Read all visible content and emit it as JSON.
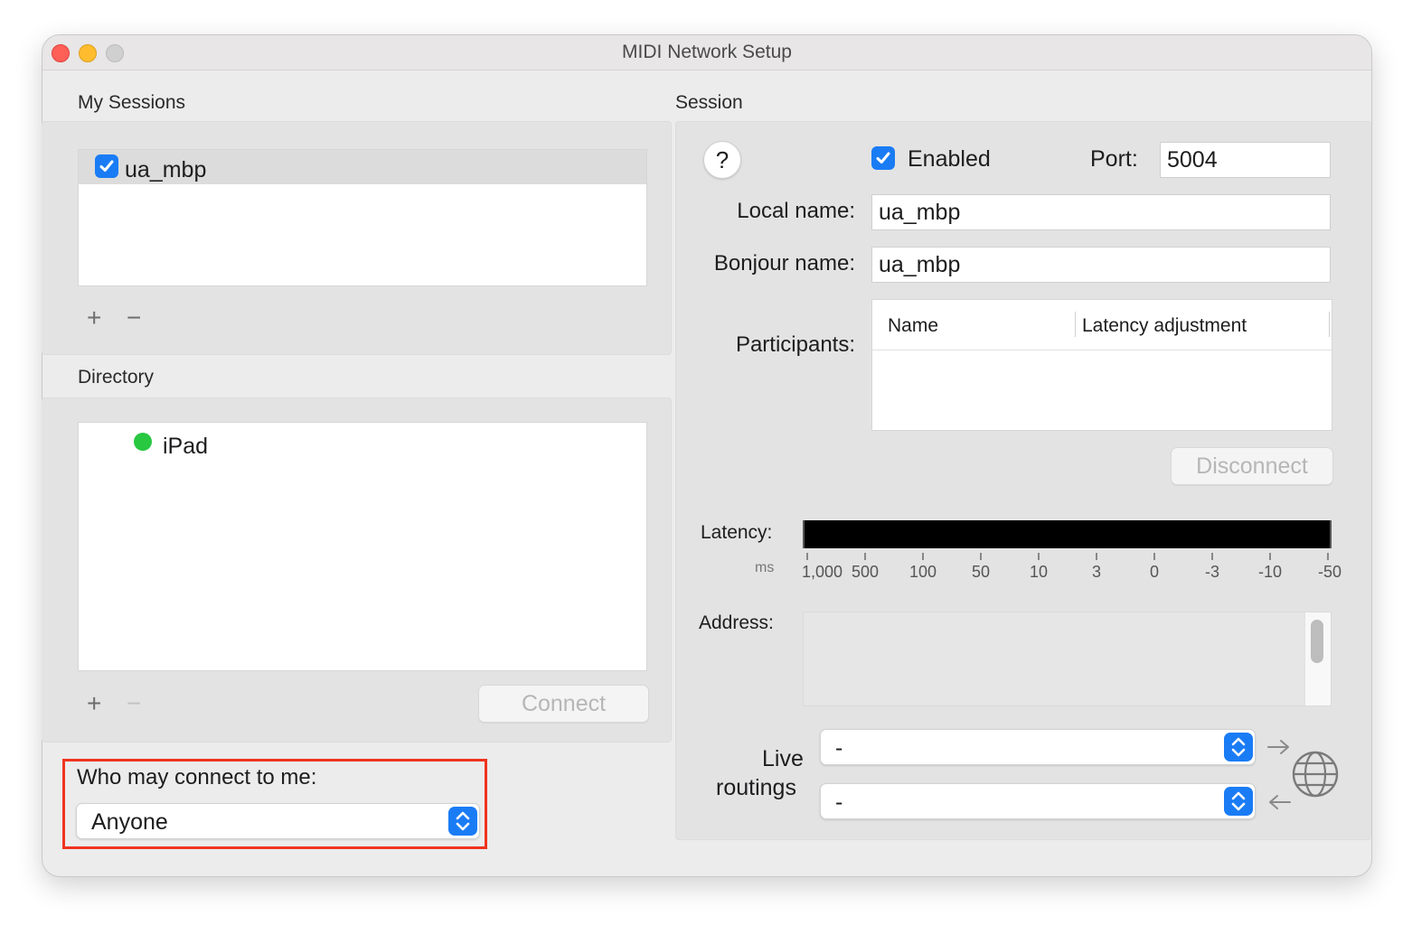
{
  "window": {
    "title": "MIDI Network Setup"
  },
  "my_sessions": {
    "label": "My Sessions",
    "items": [
      {
        "name": "ua_mbp",
        "checked": true
      }
    ],
    "add_label": "+",
    "remove_label": "−"
  },
  "directory": {
    "label": "Directory",
    "items": [
      {
        "name": "iPad",
        "status_color": "#28c840"
      }
    ],
    "add_label": "+",
    "remove_label": "−",
    "connect_label": "Connect"
  },
  "who_may_connect": {
    "label": "Who may connect to me:",
    "value": "Anyone"
  },
  "session": {
    "label": "Session",
    "help_label": "?",
    "enabled_label": "Enabled",
    "enabled": true,
    "port_label": "Port:",
    "port_value": "5004",
    "local_name_label": "Local name:",
    "local_name_value": "ua_mbp",
    "bonjour_name_label": "Bonjour name:",
    "bonjour_name_value": "ua_mbp",
    "participants_label": "Participants:",
    "participants_columns": [
      "Name",
      "Latency adjustment"
    ],
    "disconnect_label": "Disconnect",
    "latency_label": "Latency:",
    "latency_unit": "ms",
    "latency_ticks": [
      "1,000",
      "500",
      "100",
      "50",
      "10",
      "3",
      "0",
      "-3",
      "-10",
      "-50"
    ],
    "address_label": "Address:",
    "live_routings_label_1": "Live",
    "live_routings_label_2": "routings",
    "routing_out_value": "-",
    "routing_in_value": "-"
  },
  "colors": {
    "accent": "#1a7cf5",
    "highlight_box": "#f0341f"
  }
}
